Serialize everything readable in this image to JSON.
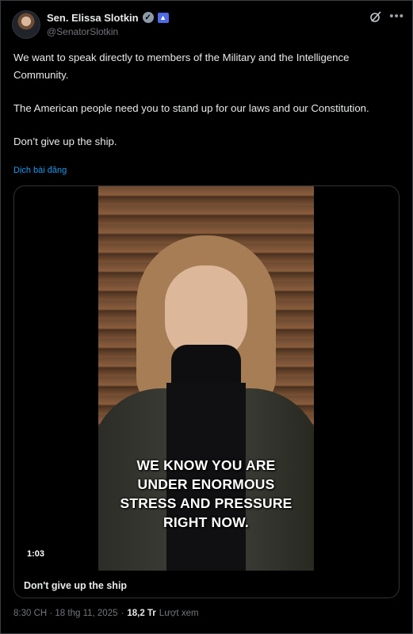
{
  "author": {
    "display_name": "Sen. Elissa Slotkin",
    "handle": "@SenatorSlotkin",
    "verified_icon": "check-circle-icon",
    "badge_icon": "government-badge-icon"
  },
  "tweet": {
    "paragraphs": [
      "We want to speak directly to members of the Military and the Intelligence Community.",
      "The American people need you to stand up for our laws and our Constitution.",
      "Don’t give up the ship."
    ],
    "translate_label": "Dịch bài đăng"
  },
  "media": {
    "caption": "WE KNOW YOU ARE\nUNDER ENORMOUS\nSTRESS AND PRESSURE\nRIGHT NOW.",
    "duration": "1:03",
    "title": "Don't give up the ship"
  },
  "footer": {
    "timestamp": "8:30 CH · 18 thg 11, 2025",
    "separator": "·",
    "views_count": "18,2 Tr",
    "views_label": "Lượt xem"
  },
  "colors": {
    "background": "#000000",
    "text": "#e7e9ea",
    "muted": "#71767b",
    "link": "#1d9bf0"
  }
}
